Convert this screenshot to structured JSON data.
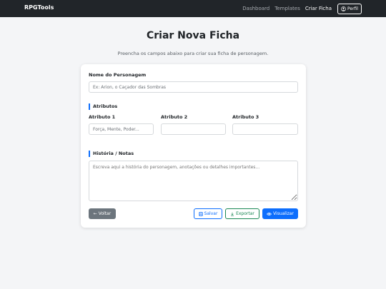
{
  "navbar": {
    "brand": "RPGTools",
    "links": [
      "Dashboard",
      "Templates",
      "Criar Ficha"
    ],
    "profile_label": "Perfil"
  },
  "page": {
    "title": "Criar Nova Ficha",
    "subtitle": "Preencha os campos abaixo para criar sua ficha de personagem."
  },
  "form": {
    "name_label": "Nome do Personagem",
    "name_placeholder": "Ex: Arion, o Caçador das Sombras",
    "attributes_title": "Atributos",
    "attributes": [
      {
        "label": "Atributo 1",
        "placeholder": "Força, Mente, Poder..."
      },
      {
        "label": "Atributo 2",
        "placeholder": ""
      },
      {
        "label": "Atributo 3",
        "placeholder": ""
      }
    ],
    "history_title": "História / Notas",
    "history_placeholder": "Escreva aqui a história do personagem, anotações ou detalhes importantes..."
  },
  "actions": {
    "back": "← Voltar",
    "save": "Salvar",
    "export": "Exportar",
    "view": "Visualizar"
  },
  "colors": {
    "navbar": "#212529",
    "primary": "#0d6efd",
    "success": "#198754",
    "secondary": "#6c757d"
  }
}
